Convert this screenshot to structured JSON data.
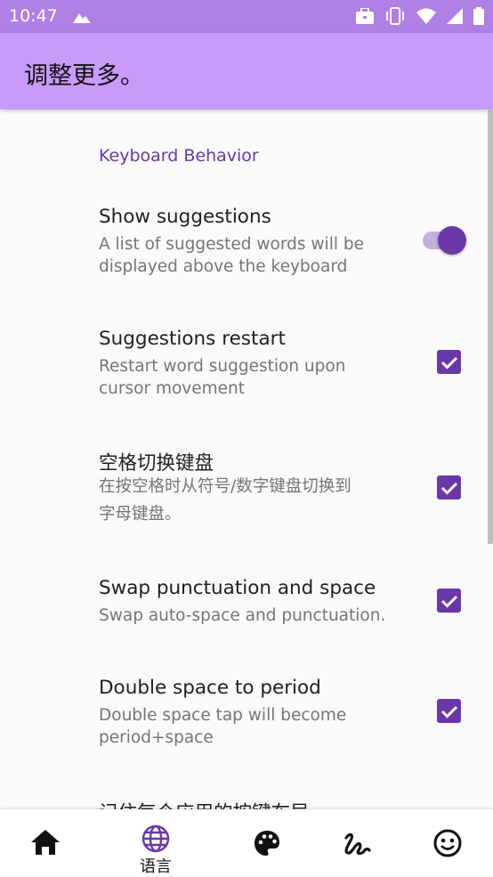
{
  "status_bar": {
    "time": "10:47",
    "icons": [
      "notification-mountain-icon",
      "briefcase-icon",
      "vibrate-icon",
      "wifi-icon",
      "signal-icon",
      "battery-icon"
    ]
  },
  "app_bar": {
    "title": "调整更多。"
  },
  "section": {
    "title": "Keyboard Behavior"
  },
  "prefs": [
    {
      "title": "Show suggestions",
      "summary_line1": "A list of suggested words will be",
      "summary_line2": "displayed above the keyboard",
      "control": "switch",
      "checked": true
    },
    {
      "title": "Suggestions restart",
      "summary_line1": "Restart word suggestion upon",
      "summary_line2": "cursor movement",
      "control": "checkbox",
      "checked": true
    },
    {
      "title": "空格切换键盘",
      "summary_line1": "在按空格时从符号/数字键盘切换到",
      "summary_line2": "字母键盘。",
      "control": "checkbox",
      "checked": true
    },
    {
      "title": "Swap punctuation and space",
      "summary_line1": "Swap auto-space and punctuation.",
      "summary_line2": "",
      "control": "checkbox",
      "checked": true
    },
    {
      "title": "Double space to period",
      "summary_line1": "Double space tap will become",
      "summary_line2": "period+space",
      "control": "checkbox",
      "checked": true
    },
    {
      "title": "记住每个应用的按键布局",
      "summary_line1": "",
      "summary_line2": "",
      "control": "none",
      "checked": null
    }
  ],
  "bottom_nav": {
    "items": [
      {
        "icon": "home-icon",
        "label": "",
        "selected": false
      },
      {
        "icon": "globe-icon",
        "label": "语言",
        "selected": true
      },
      {
        "icon": "palette-icon",
        "label": "",
        "selected": false
      },
      {
        "icon": "gesture-icon",
        "label": "",
        "selected": false
      },
      {
        "icon": "emoji-icon",
        "label": "",
        "selected": false
      }
    ]
  },
  "colors": {
    "status_bar": "#b07fe3",
    "app_bar": "#c99bf9",
    "accent": "#6a37a8",
    "switch_track": "#c4b0de",
    "background": "#fafafa"
  }
}
